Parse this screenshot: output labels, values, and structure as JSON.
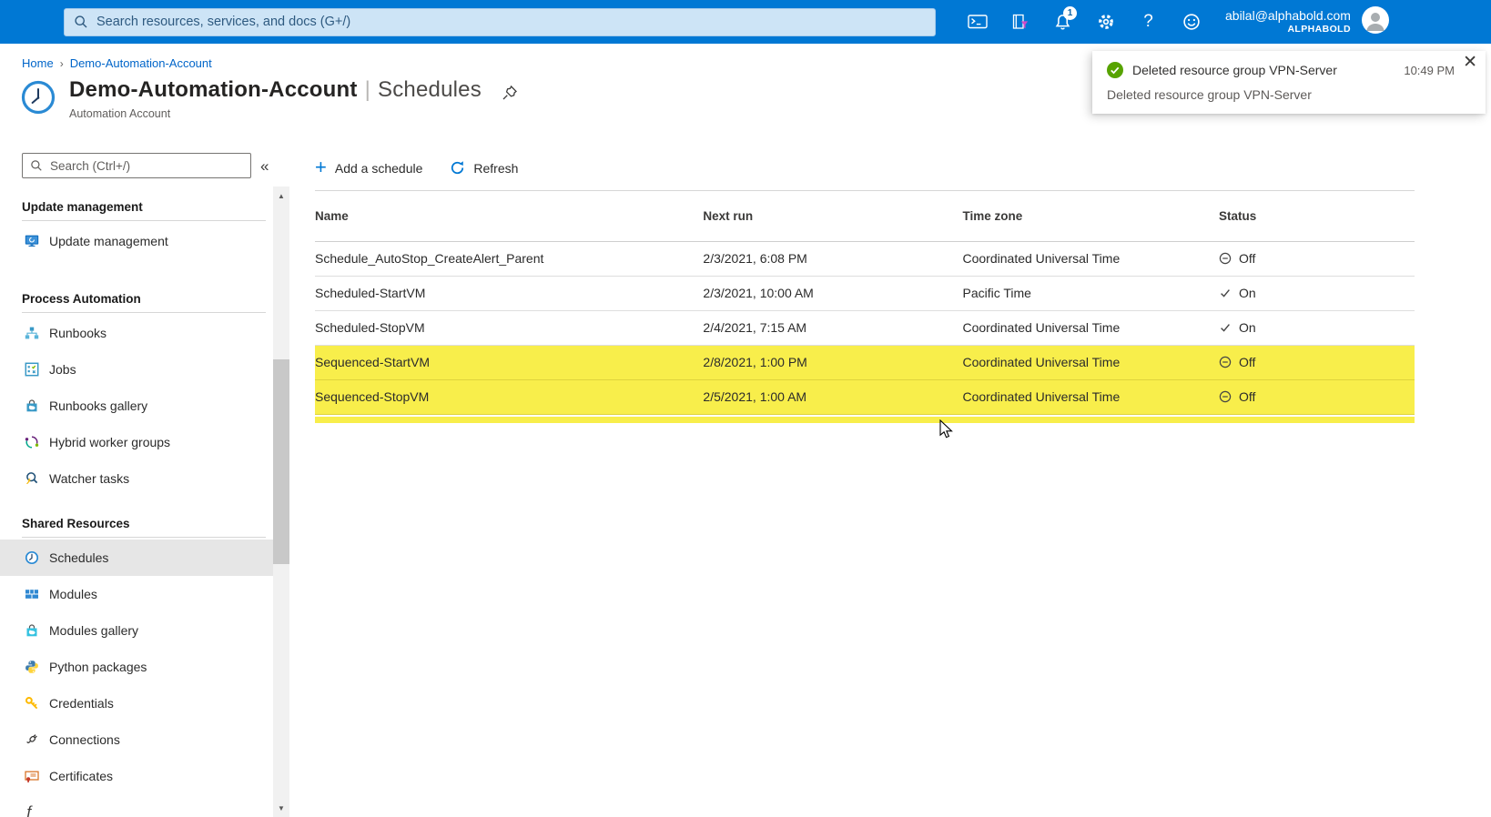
{
  "topbar": {
    "search_placeholder": "Search resources, services, and docs (G+/)",
    "notification_count": "1",
    "email": "abilal@alphabold.com",
    "tenant": "ALPHABOLD",
    "icons": [
      "cloud-shell",
      "directory-filter",
      "notifications",
      "settings",
      "help",
      "feedback"
    ]
  },
  "toast": {
    "title": "Deleted resource group VPN-Server",
    "time": "10:49 PM",
    "body": "Deleted resource group VPN-Server",
    "close_glyph": "✕"
  },
  "breadcrumb": {
    "home": "Home",
    "separator": "›",
    "current": "Demo-Automation-Account"
  },
  "page": {
    "title_primary": "Demo-Automation-Account",
    "title_separator": "|",
    "title_secondary": "Schedules",
    "subtitle": "Automation Account"
  },
  "sidebar": {
    "search_placeholder": "Search (Ctrl+/)",
    "collapse_glyph": "«",
    "partial_item_glyph": "ƒ",
    "scroll_up_glyph": "▲",
    "scroll_down_glyph": "▼",
    "sections": [
      {
        "header": "Update management",
        "items": [
          {
            "label": "Update management",
            "icon": "update-management-icon"
          }
        ]
      },
      {
        "header": "Process Automation",
        "items": [
          {
            "label": "Runbooks",
            "icon": "runbooks-icon"
          },
          {
            "label": "Jobs",
            "icon": "jobs-icon"
          },
          {
            "label": "Runbooks gallery",
            "icon": "runbooks-gallery-icon"
          },
          {
            "label": "Hybrid worker groups",
            "icon": "hybrid-worker-groups-icon"
          },
          {
            "label": "Watcher tasks",
            "icon": "watcher-tasks-icon"
          }
        ]
      },
      {
        "header": "Shared Resources",
        "items": [
          {
            "label": "Schedules",
            "icon": "schedules-icon",
            "selected": true
          },
          {
            "label": "Modules",
            "icon": "modules-icon"
          },
          {
            "label": "Modules gallery",
            "icon": "modules-gallery-icon"
          },
          {
            "label": "Python packages",
            "icon": "python-packages-icon"
          },
          {
            "label": "Credentials",
            "icon": "credentials-icon"
          },
          {
            "label": "Connections",
            "icon": "connections-icon"
          },
          {
            "label": "Certificates",
            "icon": "certificates-icon"
          }
        ]
      }
    ]
  },
  "commandbar": {
    "add": "Add a schedule",
    "refresh": "Refresh"
  },
  "table": {
    "columns": [
      "Name",
      "Next run",
      "Time zone",
      "Status"
    ],
    "rows": [
      {
        "name": "Schedule_AutoStop_CreateAlert_Parent",
        "next_run": "2/3/2021, 6:08 PM",
        "time_zone": "Coordinated Universal Time",
        "status": "Off",
        "highlighted": false
      },
      {
        "name": "Scheduled-StartVM",
        "next_run": "2/3/2021, 10:00 AM",
        "time_zone": "Pacific Time",
        "status": "On",
        "highlighted": false
      },
      {
        "name": "Scheduled-StopVM",
        "next_run": "2/4/2021, 7:15 AM",
        "time_zone": "Coordinated Universal Time",
        "status": "On",
        "highlighted": false
      },
      {
        "name": "Sequenced-StartVM",
        "next_run": "2/8/2021, 1:00 PM",
        "time_zone": "Coordinated Universal Time",
        "status": "Off",
        "highlighted": true
      },
      {
        "name": "Sequenced-StopVM",
        "next_run": "2/5/2021, 1:00 AM",
        "time_zone": "Coordinated Universal Time",
        "status": "Off",
        "highlighted": true
      }
    ]
  },
  "colors": {
    "topbar": "#0078d4",
    "accent": "#0078d4",
    "highlight": "#f8ee4b",
    "success": "#57a300",
    "selected_nav": "#e6e6e6"
  }
}
